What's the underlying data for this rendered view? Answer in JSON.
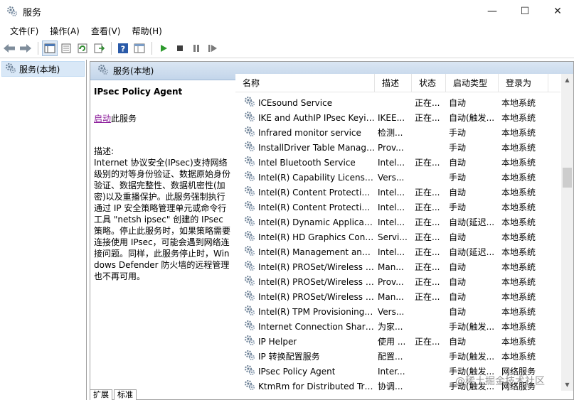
{
  "window": {
    "title": "服务",
    "min": "—",
    "max": "☐",
    "close": "✕"
  },
  "menu": [
    "文件(F)",
    "操作(A)",
    "查看(V)",
    "帮助(H)"
  ],
  "toolbar": {
    "icons": [
      "back-arrow-icon",
      "forward-arrow-icon",
      "console-tree-icon",
      "properties-icon",
      "refresh-icon",
      "export-list-icon",
      "help-icon",
      "view-icon",
      "play-icon",
      "stop-icon",
      "pause-icon",
      "resume-icon"
    ]
  },
  "tree": {
    "root_label": "服务(本地)"
  },
  "panel": {
    "header": "服务(本地)"
  },
  "description": {
    "title": "IPsec Policy Agent",
    "start_link": "启动",
    "start_suffix": "此服务",
    "label": "描述:",
    "body": "Internet 协议安全(IPsec)支持网络级别的对等身份验证、数据原始身份验证、数据完整性、数据机密性(加密)以及重播保护。此服务强制执行通过 IP 安全策略管理单元或命令行工具 \"netsh ipsec\" 创建的 IPsec 策略。停止此服务时，如果策略需要连接使用 IPsec，可能会遇到网络连接问题。同样，此服务停止时，Windows Defender 防火墙的远程管理也不再可用。"
  },
  "columns": {
    "name": "名称",
    "desc": "描述",
    "status": "状态",
    "startup": "启动类型",
    "logon": "登录为",
    "sort_caret": "^"
  },
  "services": [
    {
      "name": "ICEsound Service",
      "desc": "",
      "status": "正在...",
      "startup": "自动",
      "logon": "本地系统"
    },
    {
      "name": "IKE and AuthIP IPsec Keyin...",
      "desc": "IKEE...",
      "status": "正在...",
      "startup": "自动(触发...",
      "logon": "本地系统"
    },
    {
      "name": "Infrared monitor service",
      "desc": "检测...",
      "status": "",
      "startup": "手动",
      "logon": "本地系统"
    },
    {
      "name": "InstallDriver Table Manager",
      "desc": "Prov...",
      "status": "",
      "startup": "手动",
      "logon": "本地系统"
    },
    {
      "name": "Intel Bluetooth Service",
      "desc": "Intel...",
      "status": "正在...",
      "startup": "自动",
      "logon": "本地系统"
    },
    {
      "name": "Intel(R) Capability Licensin...",
      "desc": "Vers...",
      "status": "",
      "startup": "手动",
      "logon": "本地系统"
    },
    {
      "name": "Intel(R) Content Protection ...",
      "desc": "Intel...",
      "status": "正在...",
      "startup": "自动",
      "logon": "本地系统"
    },
    {
      "name": "Intel(R) Content Protection ...",
      "desc": "Intel...",
      "status": "正在...",
      "startup": "手动",
      "logon": "本地系统"
    },
    {
      "name": "Intel(R) Dynamic Applicatio...",
      "desc": "Intel...",
      "status": "正在...",
      "startup": "自动(延迟...",
      "logon": "本地系统"
    },
    {
      "name": "Intel(R) HD Graphics Contr...",
      "desc": "Servi...",
      "status": "正在...",
      "startup": "自动",
      "logon": "本地系统"
    },
    {
      "name": "Intel(R) Management and ...",
      "desc": "Intel...",
      "status": "正在...",
      "startup": "自动(延迟...",
      "logon": "本地系统"
    },
    {
      "name": "Intel(R) PROSet/Wireless E...",
      "desc": "Man...",
      "status": "正在...",
      "startup": "自动",
      "logon": "本地系统"
    },
    {
      "name": "Intel(R) PROSet/Wireless R...",
      "desc": "Prov...",
      "status": "正在...",
      "startup": "自动",
      "logon": "本地系统"
    },
    {
      "name": "Intel(R) PROSet/Wireless Z...",
      "desc": "Man...",
      "status": "正在...",
      "startup": "自动",
      "logon": "本地系统"
    },
    {
      "name": "Intel(R) TPM Provisioning S...",
      "desc": "Vers...",
      "status": "",
      "startup": "自动",
      "logon": "本地系统"
    },
    {
      "name": "Internet Connection Sharin...",
      "desc": "为家...",
      "status": "",
      "startup": "手动(触发...",
      "logon": "本地系统"
    },
    {
      "name": "IP Helper",
      "desc": "使用 ...",
      "status": "正在...",
      "startup": "自动",
      "logon": "本地系统"
    },
    {
      "name": "IP 转换配置服务",
      "desc": "配置...",
      "status": "",
      "startup": "手动(触发...",
      "logon": "本地系统"
    },
    {
      "name": "IPsec Policy Agent",
      "desc": "Inter...",
      "status": "",
      "startup": "手动(触发...",
      "logon": "网络服务"
    },
    {
      "name": "KtmRm for Distributed Tra...",
      "desc": "协调...",
      "status": "",
      "startup": "手动(触发...",
      "logon": "网络服务"
    }
  ],
  "tabs": [
    "扩展",
    "标准"
  ],
  "watermark": "@稀土掘金技术社区",
  "colors": {
    "link": "#8b1a9a",
    "header_blue": "#c3d5ea",
    "selected_tree": "#d9e8f7"
  }
}
